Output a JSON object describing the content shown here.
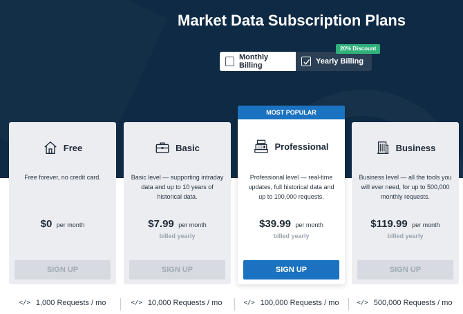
{
  "page": {
    "title": "Market Data Subscription Plans"
  },
  "billing": {
    "monthly_label": "Monthly Billing",
    "yearly_label": "Yearly Billing",
    "discount_badge": "20% Discount",
    "selected": "yearly"
  },
  "plans": [
    {
      "name": "Free",
      "icon": "house-icon",
      "description": "Free forever, no credit card.",
      "price": "$0",
      "per": "per month",
      "billed": "",
      "button": "SIGN UP",
      "requests": "1,000 Requests / mo"
    },
    {
      "name": "Basic",
      "icon": "briefcase-icon",
      "description": "Basic level — supporting intraday data and up to 10 years of historical data.",
      "price": "$7.99",
      "per": "per month",
      "billed": "billed yearly",
      "button": "SIGN UP",
      "requests": "10,000 Requests / mo"
    },
    {
      "name": "Professional",
      "icon": "cash-register-icon",
      "badge": "MOST POPULAR",
      "description": "Professional level — real-time updates, full historical data and up to 100,000 requests.",
      "price": "$39.99",
      "per": "per month",
      "billed": "billed yearly",
      "button": "SIGN UP",
      "requests": "100,000 Requests / mo"
    },
    {
      "name": "Business",
      "icon": "office-building-icon",
      "description": "Business level — all the tools you will ever need, for up to 500,000 monthly requests.",
      "price": "$119.99",
      "per": "per month",
      "billed": "billed yearly",
      "button": "SIGN UP",
      "requests": "500,000 Requests / mo"
    }
  ],
  "requests_icon": "</>",
  "colors": {
    "hero_bg": "#0f2a44",
    "accent": "#1b72c0",
    "discount": "#2fb17a",
    "card_bg": "#ebedf1"
  }
}
